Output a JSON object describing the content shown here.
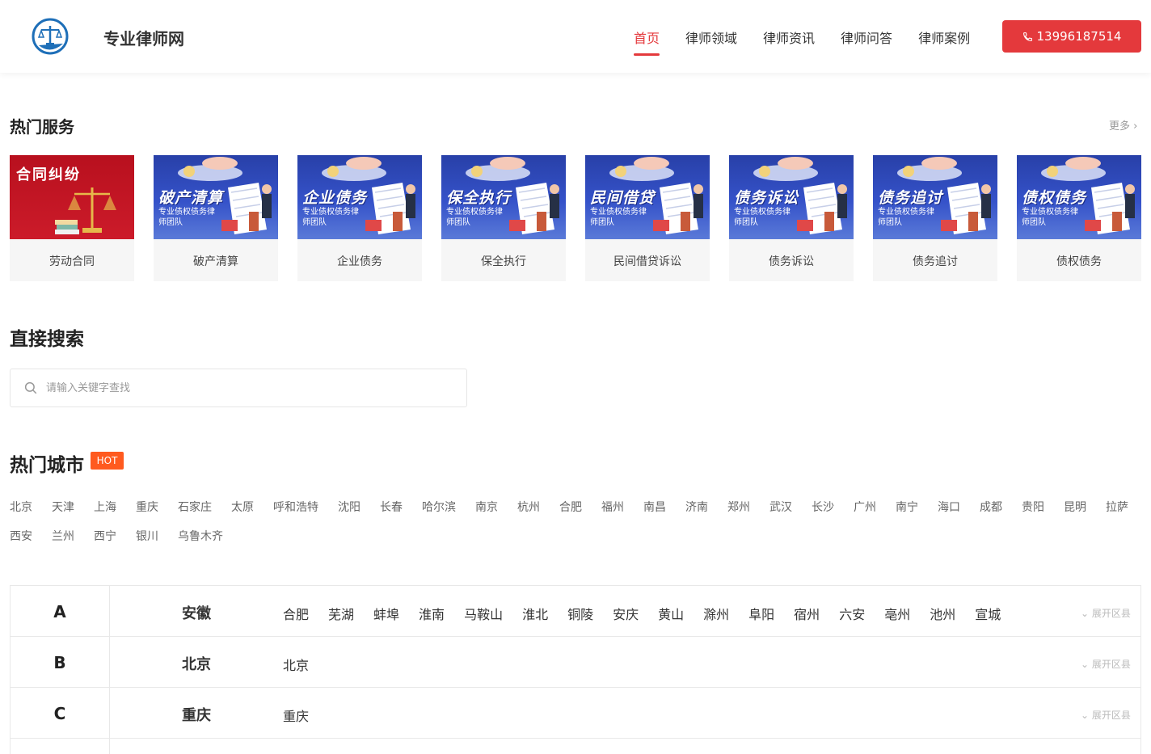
{
  "header": {
    "site_name": "专业律师网",
    "nav": [
      "首页",
      "律师领域",
      "律师资讯",
      "律师问答",
      "律师案例"
    ],
    "phone": "13996187514"
  },
  "hot_services": {
    "title": "热门服务",
    "more": "更多",
    "cards": [
      {
        "banner": "合同纠纷",
        "subtitle": "",
        "label": "劳动合同",
        "style": "red"
      },
      {
        "banner": "破产清算",
        "subtitle": "专业债权债务律师团队",
        "label": "破产清算",
        "style": "blue"
      },
      {
        "banner": "企业债务",
        "subtitle": "专业债权债务律师团队",
        "label": "企业债务",
        "style": "blue"
      },
      {
        "banner": "保全执行",
        "subtitle": "专业债权债务律师团队",
        "label": "保全执行",
        "style": "blue"
      },
      {
        "banner": "民间借贷",
        "subtitle": "专业债权债务律师团队",
        "label": "民间借贷诉讼",
        "style": "blue"
      },
      {
        "banner": "债务诉讼",
        "subtitle": "专业债权债务律师团队",
        "label": "债务诉讼",
        "style": "blue"
      },
      {
        "banner": "债务追讨",
        "subtitle": "专业债权债务律师团队",
        "label": "债务追讨",
        "style": "blue"
      },
      {
        "banner": "债权债务",
        "subtitle": "专业债权债务律师团队",
        "label": "债权债务",
        "style": "blue"
      }
    ]
  },
  "search": {
    "title": "直接搜索",
    "placeholder": "请输入关键字查找"
  },
  "hot_cities": {
    "title": "热门城市",
    "badge": "HOT",
    "row1": [
      "北京",
      "天津",
      "上海",
      "重庆",
      "石家庄",
      "太原",
      "呼和浩特",
      "沈阳",
      "长春",
      "哈尔滨",
      "南京",
      "杭州",
      "合肥",
      "福州",
      "南昌",
      "济南",
      "郑州",
      "武汉",
      "长沙",
      "广州",
      "南宁",
      "海口",
      "成都",
      "贵阳",
      "昆明",
      "拉萨"
    ],
    "row2": [
      "西安",
      "兰州",
      "西宁",
      "银川",
      "乌鲁木齐"
    ]
  },
  "regions": {
    "expand_label": "展开区县",
    "rows": [
      {
        "letter": "A",
        "province": "安徽",
        "cities": [
          "合肥",
          "芜湖",
          "蚌埠",
          "淮南",
          "马鞍山",
          "淮北",
          "铜陵",
          "安庆",
          "黄山",
          "滁州",
          "阜阳",
          "宿州",
          "六安",
          "亳州",
          "池州",
          "宣城"
        ]
      },
      {
        "letter": "B",
        "province": "北京",
        "cities": [
          "北京"
        ]
      },
      {
        "letter": "C",
        "province": "重庆",
        "cities": [
          "重庆"
        ]
      }
    ]
  },
  "colors": {
    "accent": "#e4393c",
    "hot_badge": "#ff5a1f",
    "logo_blue": "#1e6fb8"
  }
}
